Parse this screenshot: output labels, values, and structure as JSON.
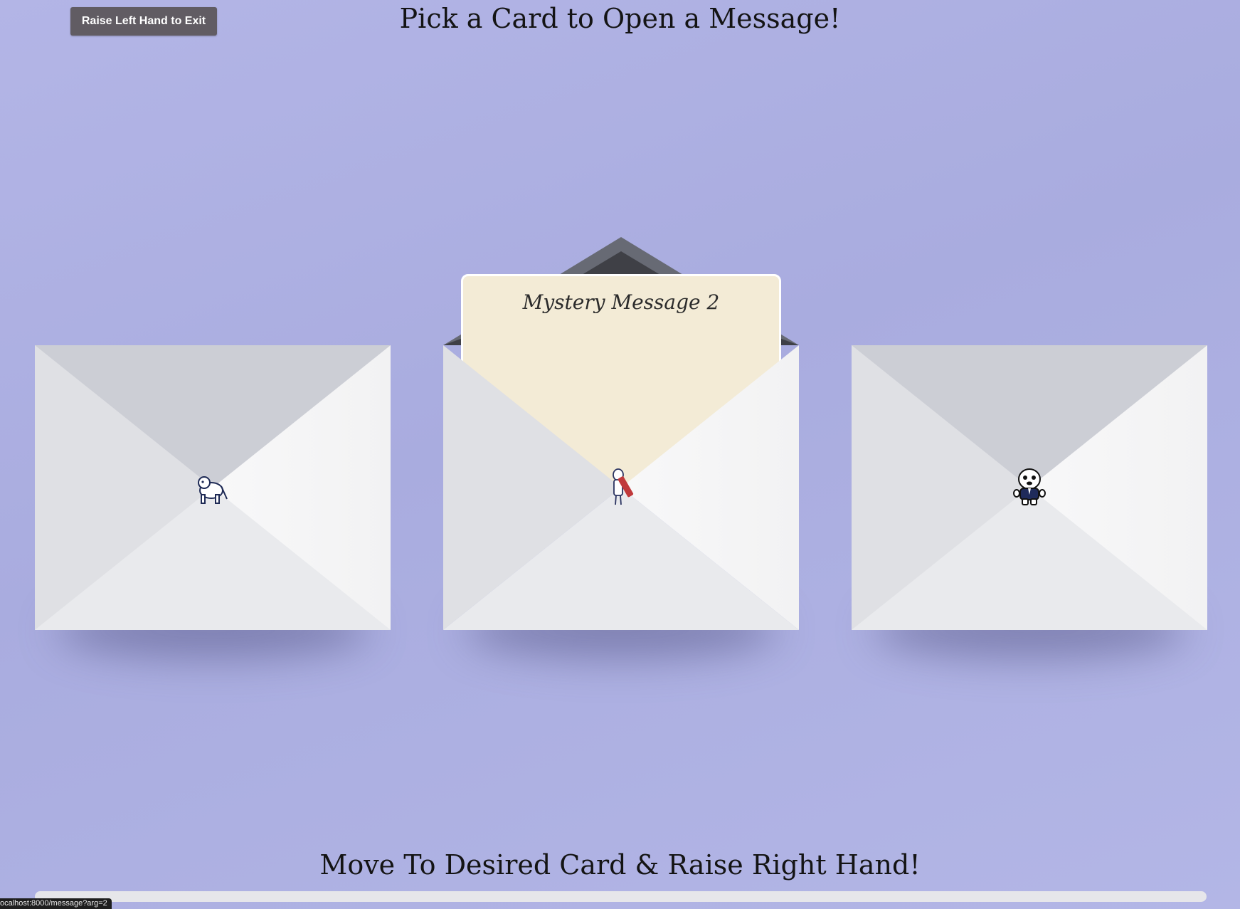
{
  "header": {
    "exit_button_label": "Raise Left Hand to Exit",
    "title": "Pick a Card to Open a Message!"
  },
  "cards": [
    {
      "name": "envelope-1",
      "state": "closed",
      "mascot_icon": "bulldog-mascot-icon"
    },
    {
      "name": "envelope-2",
      "state": "open",
      "message_title": "Mystery Message 2",
      "mascot_icon": "bulldog-mascot-icon"
    },
    {
      "name": "envelope-3",
      "state": "closed",
      "mascot_icon": "bulldog-mascot-icon"
    }
  ],
  "footer": {
    "instruction": "Move To Desired Card & Raise Right Hand!",
    "progress": 0
  },
  "status_bar": {
    "url": "ocalhost:8000/message?arg=2"
  },
  "colors": {
    "background": "#aeb0e3",
    "exit_button": "#615c63",
    "letter": "#f3ebd6",
    "envelope_flap_dark": "#676a74"
  }
}
